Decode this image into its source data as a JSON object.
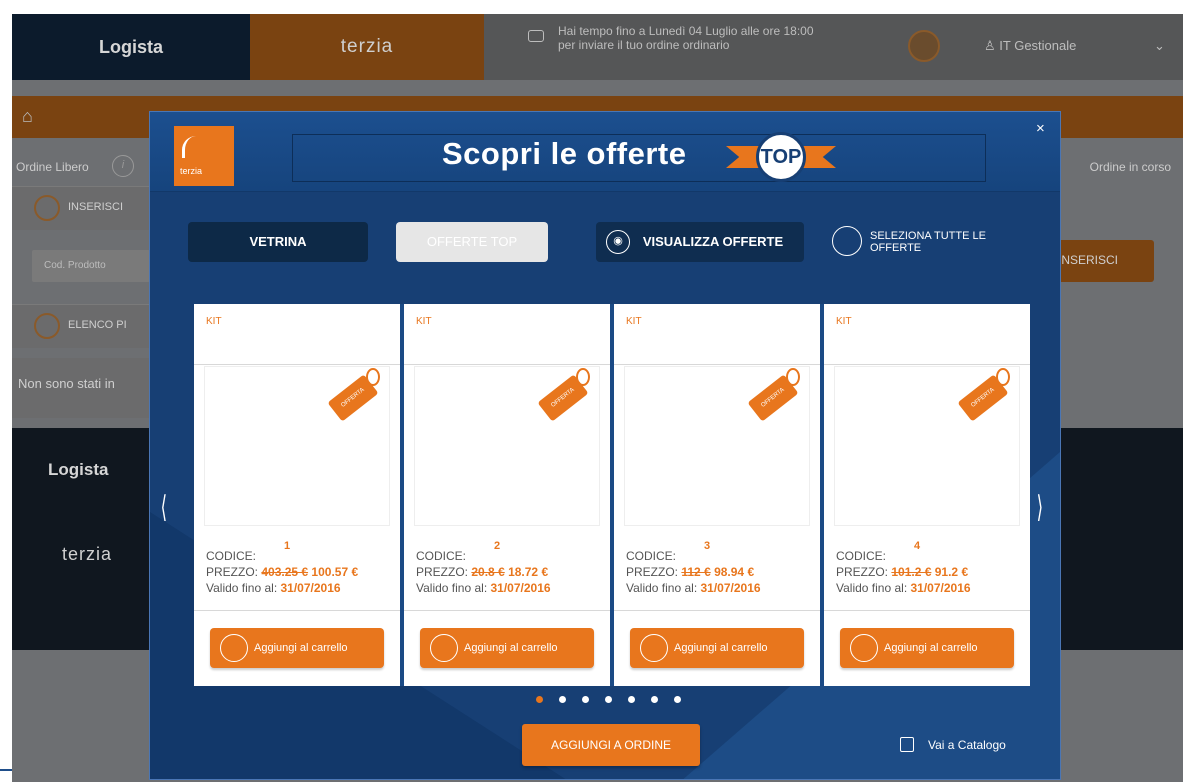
{
  "app": {
    "brand_logista": "Logista",
    "brand_terzia": "terzia",
    "notice_line1": "Hai tempo fino a Lunedì 04 Luglio alle ore 18:00",
    "notice_line2": "per inviare il tuo ordine ordinario",
    "user_name": "IT Gestionale",
    "order_free": "Ordine Libero",
    "order_in_progress": "Ordine in corso",
    "insert_section": "INSERISCI",
    "product_code_placeholder": "Cod. Prodotto",
    "insert_button": "INSERISCI",
    "list_section": "ELENCO PI",
    "empty_message": "Non sono stati in",
    "footer_logista": "Logista",
    "footer_terzia": "terzia"
  },
  "modal": {
    "logo_text": "terzia",
    "title": "Scopri le offerte",
    "top_badge": "TOP",
    "close": "×",
    "tabs": {
      "vetrina": "VETRINA",
      "offerte_top": "OFFERTE TOP",
      "visualizza": "VISUALIZZA OFFERTE"
    },
    "select_all": "SELEZIONA TUTTE LE OFFERTE",
    "nav_prev": "⟨",
    "nav_next": "⟩",
    "add_to_order": "AGGIUNGI A ORDINE",
    "catalog_link": "Vai a Catalogo",
    "page_dots": 7,
    "active_dot": 1
  },
  "cards": [
    {
      "type": "KIT",
      "tag": "OFFERTA",
      "index_label": "1",
      "code_label": "CODICE:",
      "price_label": "PREZZO:",
      "old_price": "403.25 €",
      "new_price": "100.57 €",
      "valid_label": "Valido fino al:",
      "valid_date": "31/07/2016",
      "add_label": "Aggiungi al carrello"
    },
    {
      "type": "KIT",
      "tag": "OFFERTA",
      "index_label": "2",
      "code_label": "CODICE:",
      "price_label": "PREZZO:",
      "old_price": "20.8 €",
      "new_price": "18.72 €",
      "valid_label": "Valido fino al:",
      "valid_date": "31/07/2016",
      "add_label": "Aggiungi al carrello"
    },
    {
      "type": "KIT",
      "tag": "OFFERTA",
      "index_label": "3",
      "code_label": "CODICE:",
      "price_label": "PREZZO:",
      "old_price": "112 €",
      "new_price": "98.94 €",
      "valid_label": "Valido fino al:",
      "valid_date": "31/07/2016",
      "add_label": "Aggiungi al carrello"
    },
    {
      "type": "KIT",
      "tag": "OFFERTA",
      "index_label": "4",
      "code_label": "CODICE:",
      "price_label": "PREZZO:",
      "old_price": "101.2 €",
      "new_price": "91.2 €",
      "valid_label": "Valido fino al:",
      "valid_date": "31/07/2016",
      "add_label": "Aggiungi al carrello"
    }
  ],
  "colors": {
    "accent_orange": "#e8761d",
    "modal_blue": "#173f74",
    "dark_tab": "#0d2947"
  }
}
